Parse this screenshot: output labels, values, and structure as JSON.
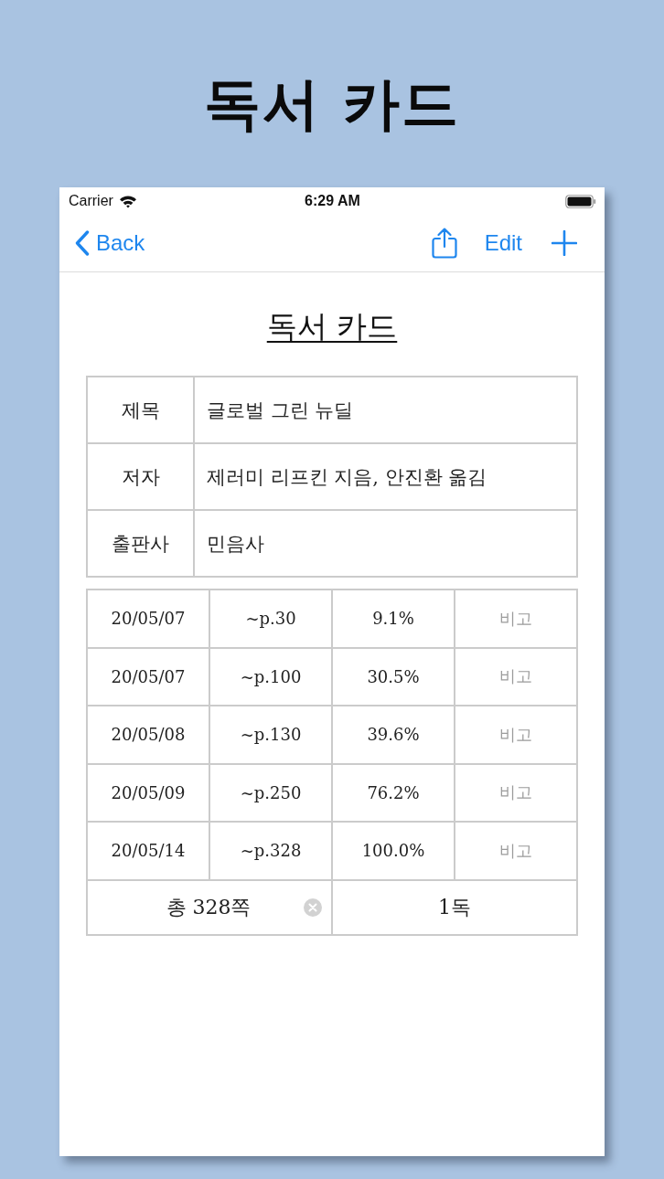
{
  "page_title": "독서 카드",
  "status_bar": {
    "carrier": "Carrier",
    "time": "6:29 AM"
  },
  "nav_bar": {
    "back": "Back",
    "edit": "Edit"
  },
  "card": {
    "title": "독서 카드",
    "info": [
      {
        "label": "제목",
        "value": "글로벌 그린 뉴딜"
      },
      {
        "label": "저자",
        "value": "제러미 리프킨 지음, 안진환 옮김"
      },
      {
        "label": "출판사",
        "value": "민음사"
      }
    ],
    "log": [
      {
        "date": "20/05/07",
        "page": "~p.30",
        "progress": "9.1%",
        "note": {
          "placeholder": "비고"
        }
      },
      {
        "date": "20/05/07",
        "page": "~p.100",
        "progress": "30.5%",
        "note": {
          "placeholder": "비고"
        }
      },
      {
        "date": "20/05/08",
        "page": "~p.130",
        "progress": "39.6%",
        "note": {
          "placeholder": "비고"
        }
      },
      {
        "date": "20/05/09",
        "page": "~p.250",
        "progress": "76.2%",
        "note": {
          "placeholder": "비고"
        }
      },
      {
        "date": "20/05/14",
        "page": "~p.328",
        "progress": "100.0%",
        "note": {
          "placeholder": "비고"
        }
      }
    ],
    "summary": {
      "total_pages": "총 328쪽",
      "reads": "1독"
    }
  }
}
